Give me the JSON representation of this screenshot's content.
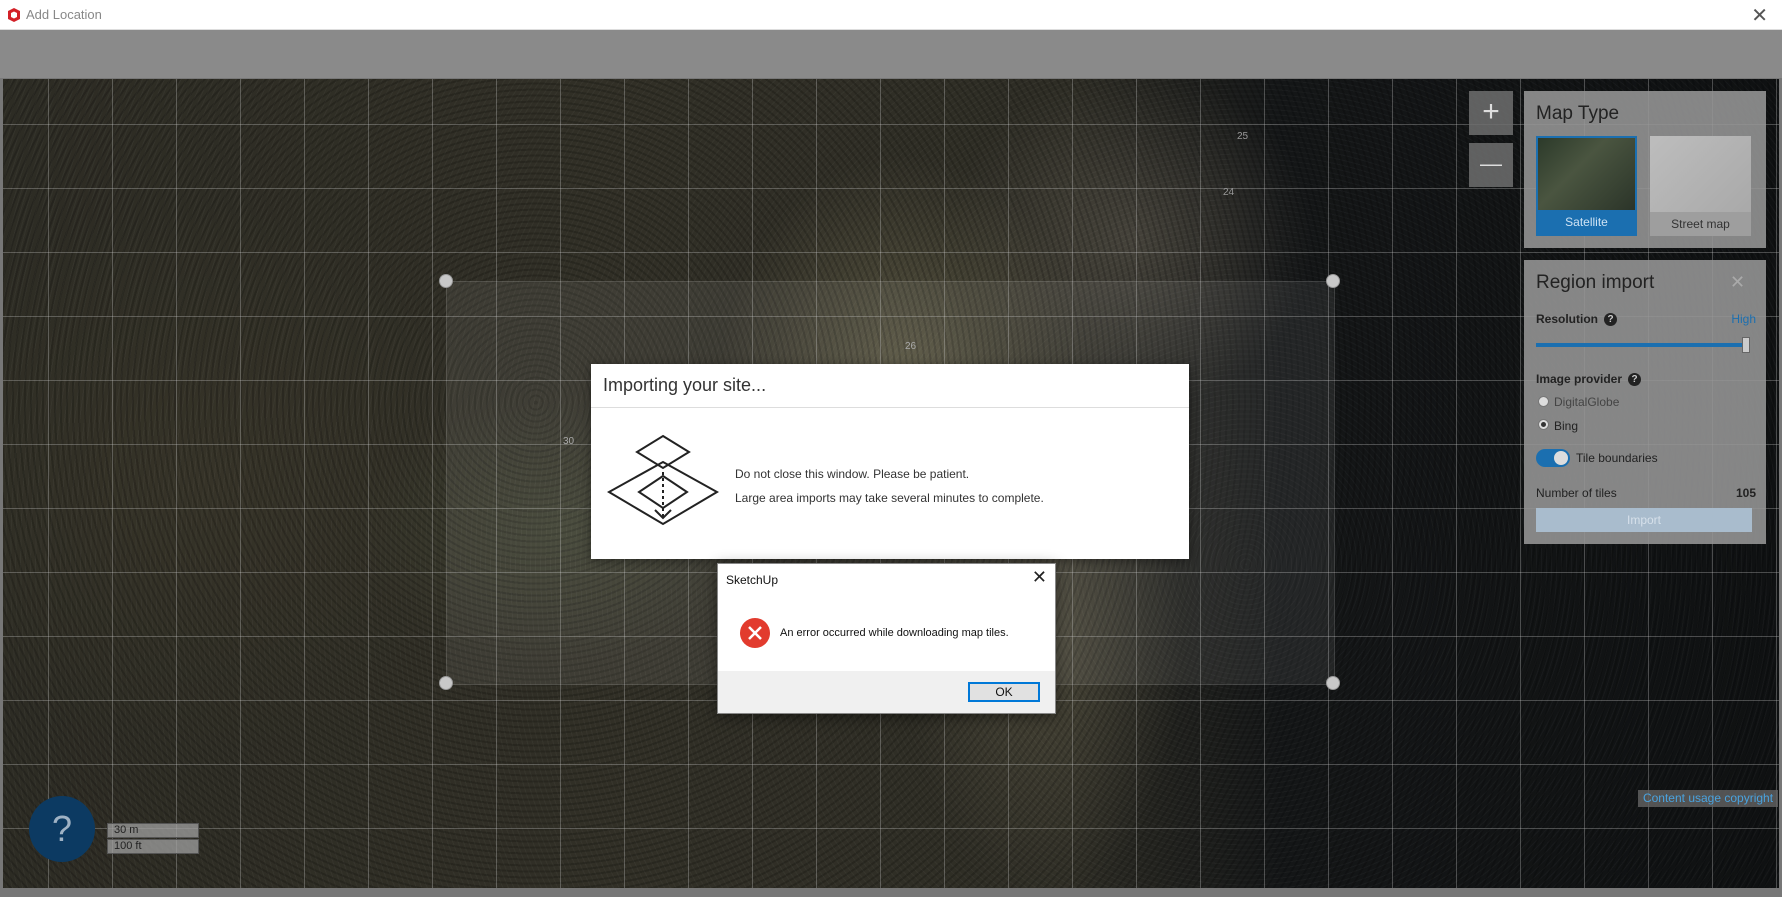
{
  "window": {
    "title": "Add Location"
  },
  "map": {
    "tile_numbers": [
      "25",
      "24",
      "26",
      "30"
    ],
    "scale_metric": "30 m",
    "scale_imperial": "100 ft",
    "copyright": "Content usage copyright",
    "help_label": "?",
    "zoom_in": "+",
    "zoom_out": "—"
  },
  "map_type": {
    "title": "Map Type",
    "options": [
      "Satellite",
      "Street map"
    ],
    "selected": "Satellite"
  },
  "region_import": {
    "title": "Region import",
    "resolution_label": "Resolution",
    "resolution_value": "High",
    "image_provider_label": "Image provider",
    "providers": [
      "DigitalGlobe",
      "Bing"
    ],
    "selected_provider": "Bing",
    "tile_boundaries_label": "Tile boundaries",
    "tile_boundaries_on": true,
    "tiles_label": "Number of tiles",
    "tiles_count": "105",
    "import_label": "Import"
  },
  "import_dialog": {
    "title": "Importing your site...",
    "line1": "Do not close this window. Please be patient.",
    "line2": "Large area imports may take several minutes to complete."
  },
  "error_dialog": {
    "caption": "SketchUp",
    "message": "An error occurred while downloading map tiles.",
    "ok_label": "OK"
  },
  "colors": {
    "accent": "#1b6fb0",
    "error": "#e23b2e",
    "help_bg": "#0c3a62"
  }
}
